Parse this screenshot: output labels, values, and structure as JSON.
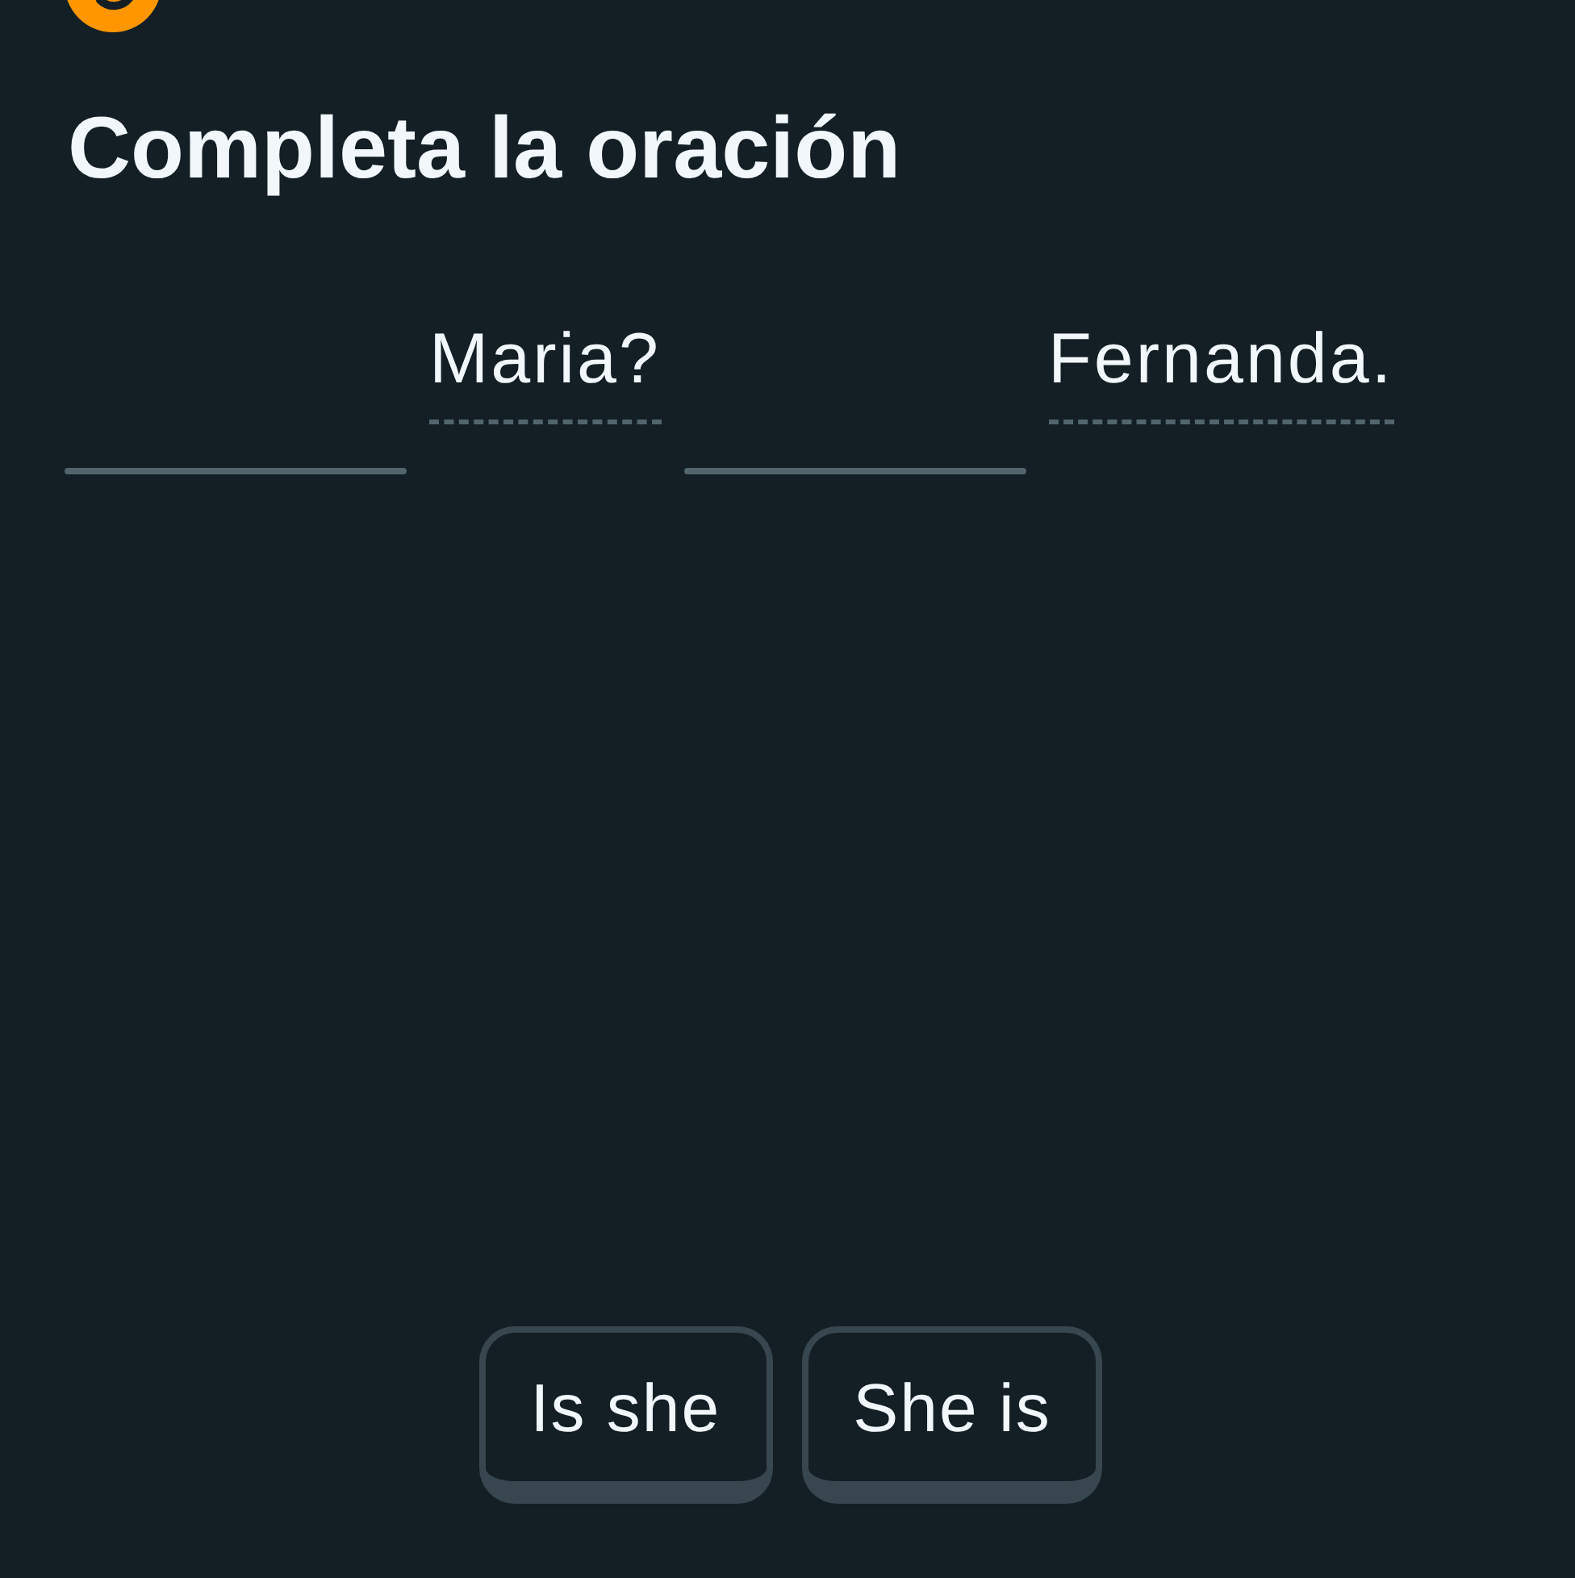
{
  "title": "Completa la oración",
  "sentence": [
    {
      "kind": "blank"
    },
    {
      "kind": "word",
      "text": "Maria?",
      "hint": true
    },
    {
      "kind": "blank"
    },
    {
      "kind": "word",
      "text": "Fernanda.",
      "hint": true
    }
  ],
  "word_bank": [
    {
      "text": "Is she"
    },
    {
      "text": "She is"
    }
  ]
}
